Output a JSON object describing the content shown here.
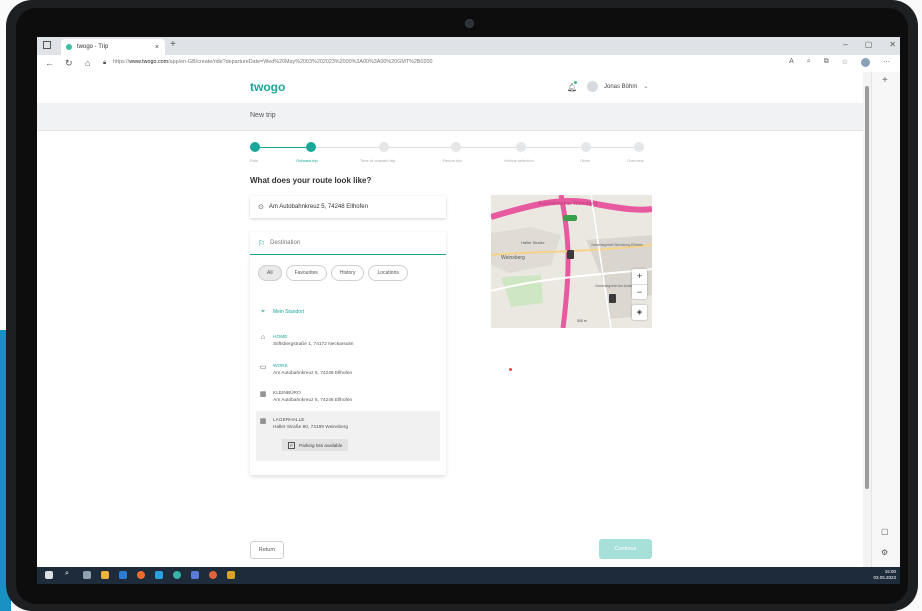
{
  "browser": {
    "tab_title": "twogo - Trip",
    "tab_close": "×",
    "new_tab": "+",
    "window_controls": [
      "–",
      "▢",
      "✕"
    ],
    "url_prefix": "https://",
    "url_domain": "www.twogo.com",
    "url_path": "/app/en-GB/create/ride?departureDate=Wed%20May%2003%202023%2000%3A00%3A00%20GMT%2B0200"
  },
  "header": {
    "logo": "twogo",
    "user_name": "Jonas Böhm"
  },
  "page_title": "New trip",
  "stepper": {
    "steps": [
      {
        "label": "Role",
        "state": "done"
      },
      {
        "label": "Outward trip",
        "state": "active"
      },
      {
        "label": "Time of outward trip",
        "state": "pending"
      },
      {
        "label": "Return trip",
        "state": "pending"
      },
      {
        "label": "Vehicle selection",
        "state": "pending"
      },
      {
        "label": "Other",
        "state": "pending"
      },
      {
        "label": "Overview",
        "state": "pending"
      }
    ]
  },
  "form": {
    "question": "What does your route look like?",
    "origin": "Am Autobahnkreuz 5, 74248 Ellhofen",
    "destination_placeholder": "Destination"
  },
  "dropdown": {
    "chips": [
      "All",
      "Favourites",
      "History",
      "Locations"
    ],
    "my_location": "Mein Standort",
    "items": [
      {
        "name": "HOME",
        "address": "Stiftsbergstraße 1, 74172 Neckarsulm"
      },
      {
        "name": "WORK",
        "address": "Am Autobahnkreuz 5, 74248 Ellhofen"
      },
      {
        "name": "KLEINBÜRO",
        "address": "Am Autobahnkreuz 5, 74248 Ellhofen"
      },
      {
        "name": "LAGERHALLE",
        "address": "Haller Straße 80, 74189 Weinsberg"
      }
    ],
    "parking_badge": "Parking lots available"
  },
  "map": {
    "labels": [
      "Autobahnkreuz Weinsberg",
      "Haller Straße",
      "Weinsberg",
      "Gewerbegebiet Weinsberg-Ellhofen",
      "Gewerbegebiet Am Autobahnkreuz"
    ],
    "zoom_in": "+",
    "zoom_out": "−",
    "scale": "500 m"
  },
  "footer": {
    "return_label": "Return",
    "continue_label": "Continue"
  },
  "taskbar": {
    "time": "15:00",
    "date": "03.05.2023"
  },
  "colors": {
    "brand": "#1aa79a",
    "continue_disabled": "#a7dfd9"
  }
}
